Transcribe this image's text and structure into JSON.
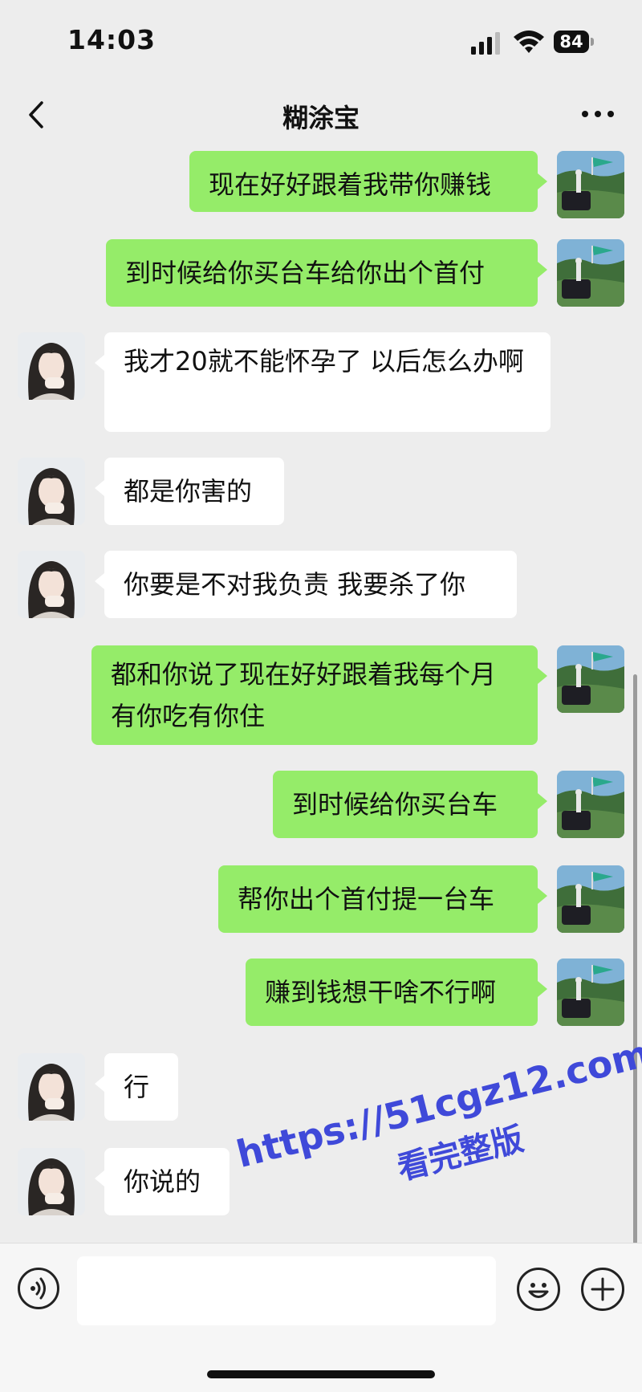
{
  "status_bar": {
    "time": "14:03",
    "battery": "84"
  },
  "nav": {
    "title": "糊涂宝"
  },
  "messages": [
    {
      "side": "me",
      "text": "现在好好跟着我带你赚钱"
    },
    {
      "side": "me",
      "text": "到时候给你买台车给你出个首付"
    },
    {
      "side": "them",
      "text": "我才20就不能怀孕了 以后怎么办啊"
    },
    {
      "side": "them",
      "text": "都是你害的"
    },
    {
      "side": "them",
      "text": "你要是不对我负责 我要杀了你"
    },
    {
      "side": "me",
      "text": "都和你说了现在好好跟着我每个月有你吃有你住"
    },
    {
      "side": "me",
      "text": "到时候给你买台车"
    },
    {
      "side": "me",
      "text": "帮你出个首付提一台车"
    },
    {
      "side": "me",
      "text": "赚到钱想干啥不行啊"
    },
    {
      "side": "them",
      "text": "行"
    },
    {
      "side": "them",
      "text": "你说的"
    }
  ],
  "watermark": {
    "url": "https://51cgz12.com",
    "caption": "看完整版"
  },
  "colors": {
    "my_bubble": "#95ec69",
    "their_bubble": "#ffffff",
    "background": "#ededed",
    "watermark": "#3f49d9"
  },
  "icons": [
    "back-chevron-icon",
    "more-dots-icon",
    "voice-icon",
    "emoji-icon",
    "plus-icon"
  ]
}
